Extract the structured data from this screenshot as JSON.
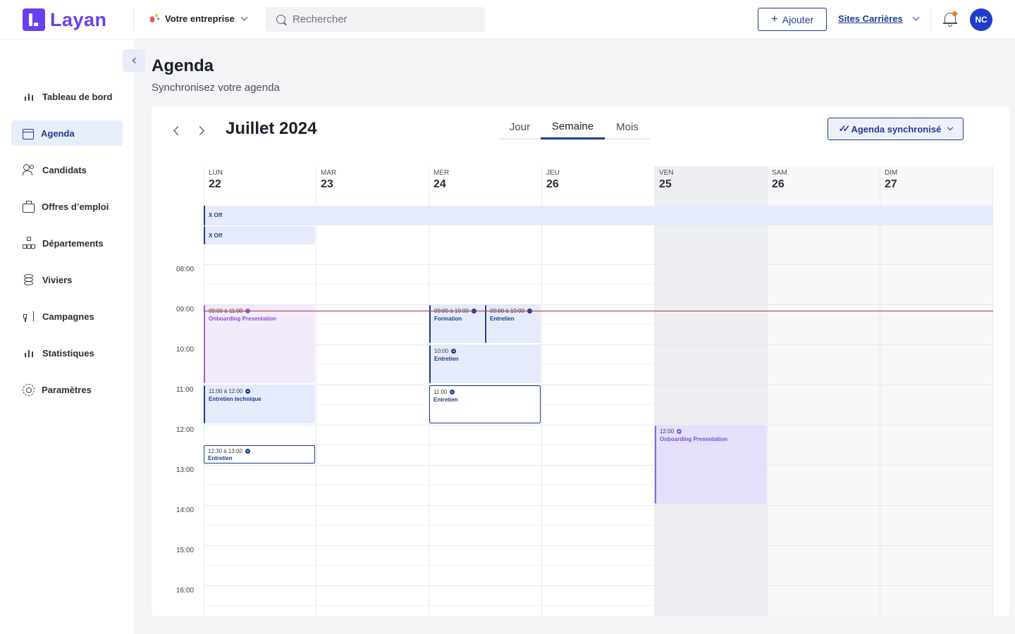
{
  "app": {
    "logo_text": "Layan",
    "brand_color": "#6b3ff0"
  },
  "topbar": {
    "company": "Votre entreprise",
    "search_placeholder": "Rechercher",
    "add_label": "Ajouter",
    "sites_label": "Sites Carrières",
    "avatar_initials": "NC"
  },
  "sidebar": {
    "items": [
      {
        "label": "Tableau de bord",
        "icon": "bar-chart-icon"
      },
      {
        "label": "Agenda",
        "icon": "calendar-icon",
        "active": true
      },
      {
        "label": "Candidats",
        "icon": "users-icon"
      },
      {
        "label": "Offres d’emploi",
        "icon": "briefcase-icon"
      },
      {
        "label": "Départements",
        "icon": "org-chart-icon"
      },
      {
        "label": "Viviers",
        "icon": "database-icon"
      },
      {
        "label": "Campagnes",
        "icon": "megaphone-icon"
      },
      {
        "label": "Statistiques",
        "icon": "bar-chart-icon"
      },
      {
        "label": "Paramètres",
        "icon": "gear-icon"
      }
    ]
  },
  "page": {
    "title": "Agenda",
    "subtitle": "Synchronisez votre agenda"
  },
  "calendar": {
    "month_label": "Juillet 2024",
    "views": [
      "Jour",
      "Semaine",
      "Mois"
    ],
    "active_view": "Semaine",
    "sync_label": "Agenda synchronisé",
    "days": [
      {
        "dow": "LUN",
        "num": "22"
      },
      {
        "dow": "MAR",
        "num": "23"
      },
      {
        "dow": "MER",
        "num": "24"
      },
      {
        "dow": "JEU",
        "num": "26"
      },
      {
        "dow": "VEN",
        "num": "25"
      },
      {
        "dow": "SAM",
        "num": "26"
      },
      {
        "dow": "DIM",
        "num": "27"
      }
    ],
    "hours": [
      "08:00",
      "09:00",
      "10:00",
      "11:00",
      "12:00",
      "13:00",
      "14:00",
      "15:00",
      "16:00"
    ],
    "allday": [
      "X Off",
      "X Off"
    ],
    "events": [
      {
        "time": "09:00 à 11:00",
        "title": "Onboarding Presentation"
      },
      {
        "time": "11:00 à 12:00",
        "title": "Entretien technique"
      },
      {
        "time": "12:30 à 13:00",
        "title": "Entretien"
      },
      {
        "time": "09:00 à 10:00",
        "title": "Formation"
      },
      {
        "time": "09:00 à 10:00",
        "title": "Entretien"
      },
      {
        "time": "10:00",
        "title": "Entretien"
      },
      {
        "time": "11:00",
        "title": "Entretien"
      },
      {
        "time": "12:00",
        "title": "Onboarding Presentation"
      }
    ]
  }
}
